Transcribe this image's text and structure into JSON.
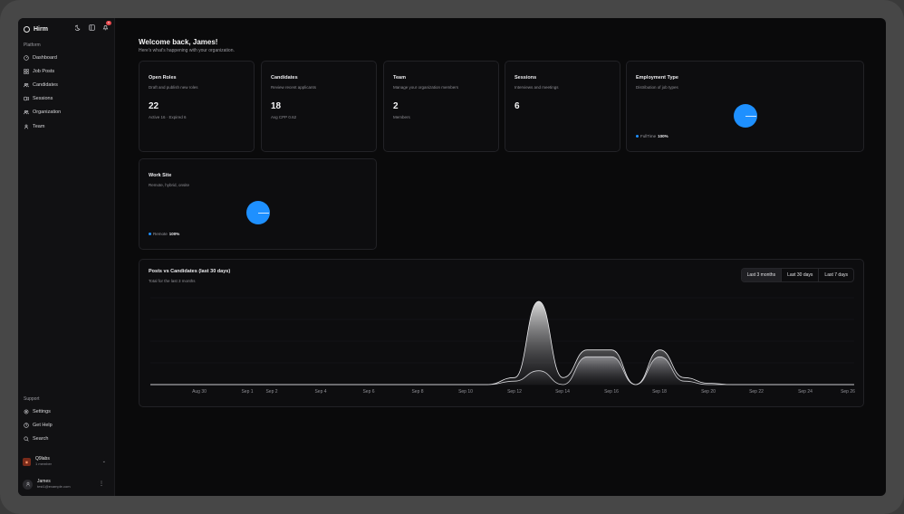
{
  "app": {
    "name": "Hirm",
    "notification_count": "9"
  },
  "sidebar": {
    "platform_label": "Platform",
    "items": [
      {
        "label": "Dashboard",
        "icon": "dashboard-icon"
      },
      {
        "label": "Job Posts",
        "icon": "grid-icon"
      },
      {
        "label": "Candidates",
        "icon": "users-icon"
      },
      {
        "label": "Sessions",
        "icon": "sessions-icon"
      },
      {
        "label": "Organization",
        "icon": "users-icon"
      },
      {
        "label": "Team",
        "icon": "team-icon"
      }
    ],
    "support_label": "Support",
    "support_items": [
      {
        "label": "Settings",
        "icon": "gear-icon"
      },
      {
        "label": "Get Help",
        "icon": "help-icon"
      },
      {
        "label": "Search",
        "icon": "search-icon"
      }
    ],
    "org": {
      "name": "Q9labs",
      "members": "1 member"
    },
    "user": {
      "name": "James",
      "email": "test1@example.com"
    }
  },
  "header": {
    "welcome": "Welcome back, James!",
    "subtitle": "Here's what's happening with your organization."
  },
  "cards": [
    {
      "title": "Open Roles",
      "subtitle": "Draft and publish new roles",
      "value": "22",
      "meta": "Active 16 · Expired 6"
    },
    {
      "title": "Candidates",
      "subtitle": "Review recent applicants",
      "value": "18",
      "meta": "Avg CPP 0.62"
    },
    {
      "title": "Team",
      "subtitle": "Manage your organization members",
      "value": "2",
      "meta": "Members"
    },
    {
      "title": "Sessions",
      "subtitle": "Interviews and meetings",
      "value": "6",
      "meta": ""
    }
  ],
  "employment": {
    "title": "Employment Type",
    "subtitle": "Distribution of job types",
    "legend_label": "FullTime",
    "legend_value": "100%",
    "color": "#1e90ff"
  },
  "worksite": {
    "title": "Work Site",
    "subtitle": "Remote, hybrid, onsite",
    "legend_label": "Remote",
    "legend_value": "100%",
    "color": "#1e90ff"
  },
  "posts_chart": {
    "title": "Posts vs Candidates (last 30 days)",
    "subtitle": "Total for the last 3 months",
    "ranges": [
      "Last 3 months",
      "Last 30 days",
      "Last 7 days"
    ],
    "selected_range": "Last 3 months"
  },
  "chart_data": {
    "type": "area",
    "x_ticks": [
      "Aug 30",
      "Sep 1",
      "Sep 2",
      "Sep 4",
      "Sep 6",
      "Sep 8",
      "Sep 10",
      "Sep 12",
      "Sep 14",
      "Sep 16",
      "Sep 18",
      "Sep 20",
      "Sep 22",
      "Sep 24",
      "Sep 26"
    ],
    "series": [
      {
        "x": [
          "Sep 12",
          "Sep 13",
          "Sep 14",
          "Sep 15",
          "Sep 16",
          "Sep 17",
          "Sep 18",
          "Sep 19",
          "Sep 20",
          "Sep 21"
        ],
        "values": [
          1,
          12,
          1,
          5,
          5,
          0,
          5,
          1,
          0.2,
          0
        ]
      },
      {
        "x": [
          "Sep 12",
          "Sep 13",
          "Sep 14",
          "Sep 15",
          "Sep 16",
          "Sep 17",
          "Sep 18",
          "Sep 19",
          "Sep 20",
          "Sep 21"
        ],
        "values": [
          0.5,
          2,
          0,
          4,
          4,
          0,
          4,
          0.5,
          0,
          0
        ]
      }
    ],
    "grid": true,
    "colors": {
      "area_top": "#ffffff",
      "area_bottom": "#2a2a2e"
    }
  }
}
